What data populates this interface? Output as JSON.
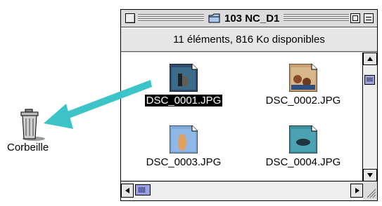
{
  "desktop": {
    "trash_label": "Corbeille"
  },
  "window": {
    "title": "103 NC_D1",
    "info": "11 éléments, 816  Ko disponibles",
    "files": [
      {
        "name": "DSC_0001.JPG",
        "selected": true
      },
      {
        "name": "DSC_0002.JPG",
        "selected": false
      },
      {
        "name": "DSC_0003.JPG",
        "selected": false
      },
      {
        "name": "DSC_0004.JPG",
        "selected": false
      }
    ]
  },
  "colors": {
    "arrow": "#3cc4c8",
    "scroll_thumb": "#9aa0e0",
    "selection": "#000000"
  },
  "icons": [
    "trash-icon",
    "folder-icon",
    "close-box-icon",
    "zoom-box-icon",
    "collapse-box-icon",
    "scroll-up-arrow-icon",
    "scroll-down-arrow-icon",
    "scroll-left-arrow-icon",
    "scroll-right-arrow-icon",
    "grow-box-icon"
  ]
}
